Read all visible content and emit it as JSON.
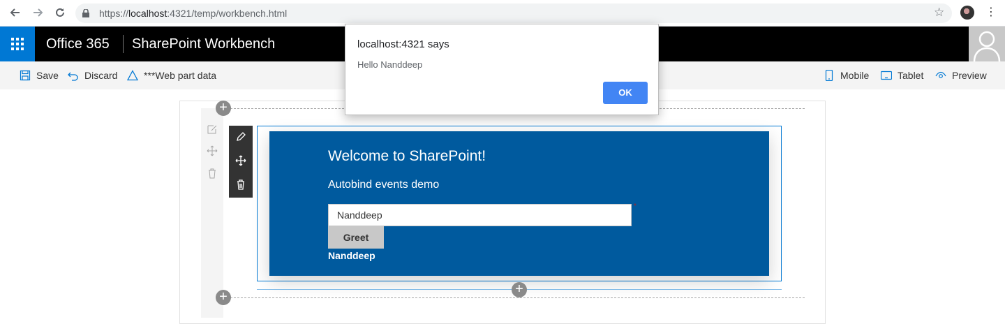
{
  "browser": {
    "url_prefix": "https://",
    "url_host": "localhost",
    "url_rest": ":4321/temp/workbench.html"
  },
  "suite": {
    "brand": "Office 365",
    "title": "SharePoint Workbench"
  },
  "commands": {
    "save": "Save",
    "discard": "Discard",
    "webpart_data": "***Web part data",
    "mobile": "Mobile",
    "tablet": "Tablet",
    "preview": "Preview"
  },
  "webpart": {
    "title": "Welcome to SharePoint!",
    "subtitle": "Autobind events demo",
    "input_value": "Nanddeep",
    "required_mark": "*",
    "button_label": "Greet",
    "output": "Nanddeep"
  },
  "alert": {
    "title": "localhost:4321 says",
    "message": "Hello Nanddeep",
    "ok_label": "OK"
  },
  "colors": {
    "suite_bar": "#000000",
    "waffle": "#0078d4",
    "webpart_bg": "#005a9e",
    "ok_button": "#4285f4"
  }
}
